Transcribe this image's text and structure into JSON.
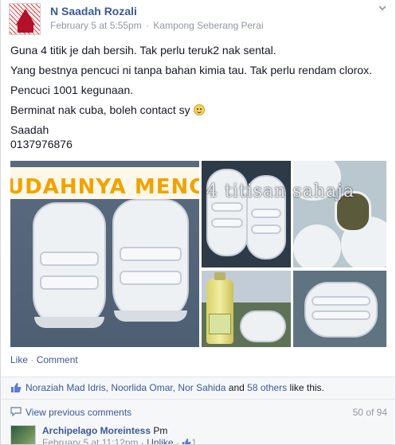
{
  "post": {
    "author": "N Saadah Rozali",
    "date": "February 5 at 5:55pm",
    "separator": "·",
    "location": "Kampong Seberang Perai",
    "lines": [
      "Guna 4 titik je dah bersih. Tak perlu teruk2 nak sental.",
      "Yang bestnya pencuci ni tanpa bahan kimia tau. Tak perlu rendam clorox.",
      "Pencuci 1001 kegunaan.",
      "Berminat nak cuba, boleh contact sy"
    ],
    "signature_name": "Saadah",
    "signature_phone": "0137976876"
  },
  "photos": {
    "banner_text": "UDAHNYA MENCUCI",
    "overlay_text": "4 titisan sahaja"
  },
  "actions": {
    "like": "Like",
    "dot": " · ",
    "comment": "Comment"
  },
  "likes": {
    "names": "Noraziah Mad Idris, Noorlida Omar, Nor Sahida",
    "and": " and ",
    "others": "58 others",
    "suffix": " like this."
  },
  "comments": {
    "view_previous": "View previous comments",
    "count": "50 of 94",
    "first": {
      "name": "Archipelago Moreintess",
      "text": "Pm",
      "date": "February 5 at 11:12pm",
      "dot": " · ",
      "unlike": "Unlike",
      "like_count": "1"
    }
  },
  "colors": {
    "link": "#3b5998",
    "meta": "#9197a3",
    "banner_text": "#f0a300"
  },
  "icons": {
    "chevron": "chevron-down-icon",
    "like": "thumbs-up-icon",
    "comment": "speech-bubble-icon",
    "smiley": "smiley-icon"
  }
}
